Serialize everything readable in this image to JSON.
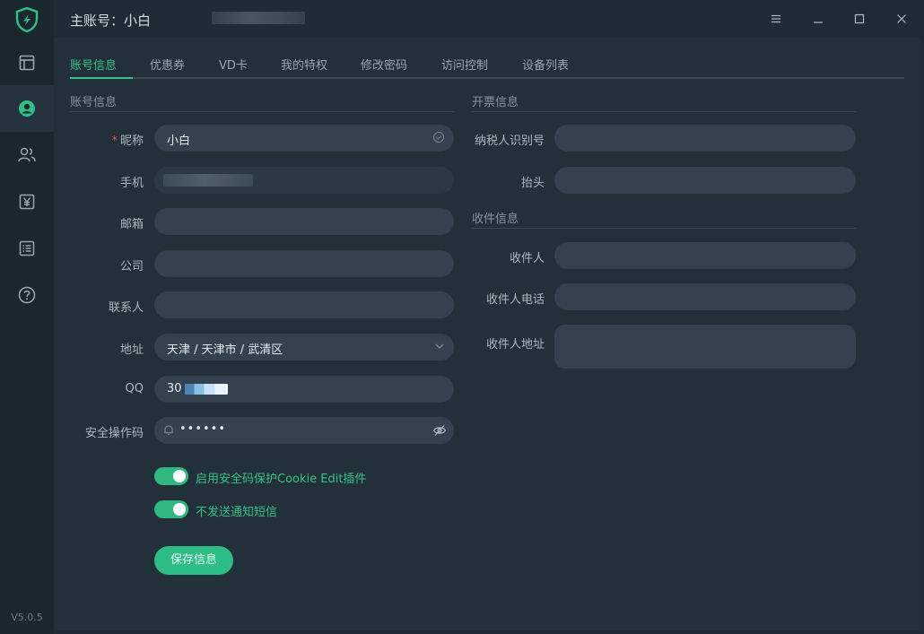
{
  "app": {
    "title": "主账号：小白",
    "version": "V5.0.5"
  },
  "rail": {
    "items": [
      {
        "name": "layout-icon"
      },
      {
        "name": "user-circle-icon"
      },
      {
        "name": "users-icon"
      },
      {
        "name": "yen-icon"
      },
      {
        "name": "list-icon"
      },
      {
        "name": "help-icon"
      }
    ]
  },
  "tabs": [
    "账号信息",
    "优惠券",
    "VD卡",
    "我的特权",
    "修改密码",
    "访问控制",
    "设备列表"
  ],
  "account": {
    "section_title": "账号信息",
    "nickname_label": "昵称",
    "nickname_value": "小白",
    "phone_label": "手机",
    "email_label": "邮箱",
    "company_label": "公司",
    "contact_label": "联系人",
    "address_label": "地址",
    "address_value": "天津 / 天津市 / 武清区",
    "qq_label": "QQ",
    "qq_value": "30",
    "security_label": "安全操作码",
    "security_value": "••••••"
  },
  "invoice": {
    "section_title": "开票信息",
    "taxid_label": "纳税人识别号",
    "header_label": "抬头"
  },
  "receiver": {
    "section_title": "收件信息",
    "name_label": "收件人",
    "phone_label": "收件人电话",
    "address_label": "收件人地址"
  },
  "toggles": [
    {
      "label": "启用安全码保护Cookie Edit插件",
      "on": true
    },
    {
      "label": "不发送通知短信",
      "on": true
    }
  ],
  "save_label": "保存信息",
  "colors": {
    "accent": "#39c08a",
    "background": "#22303a",
    "input": "#33424e",
    "required": "#e5534b"
  }
}
